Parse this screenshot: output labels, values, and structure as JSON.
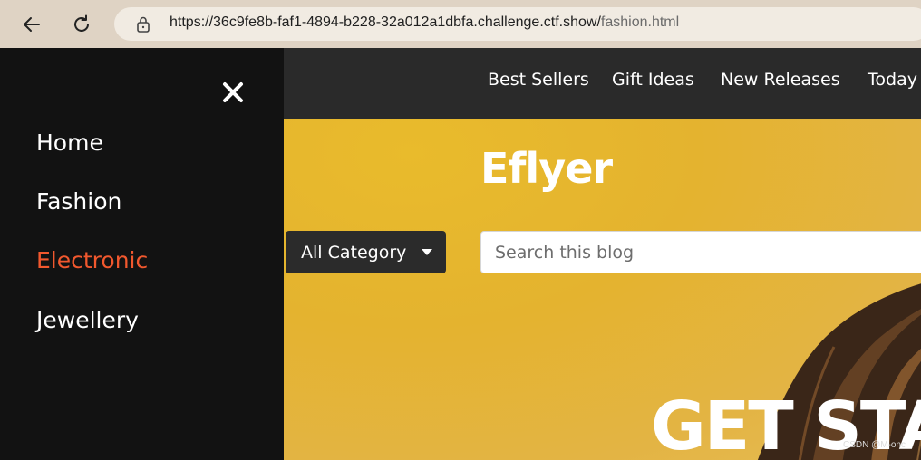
{
  "browser": {
    "url_host": "https://36c9fe8b-faf1-4894-b228-32a012a1dbfa.challenge.ctf.show/",
    "url_path": "fashion.html"
  },
  "sidenav": {
    "items": [
      {
        "label": "Home"
      },
      {
        "label": "Fashion"
      },
      {
        "label": "Electronic",
        "active": true
      },
      {
        "label": "Jewellery"
      }
    ],
    "active_color": "#f1582e"
  },
  "topnav": {
    "items": [
      {
        "label": "Best Sellers"
      },
      {
        "label": "Gift Ideas"
      },
      {
        "label": "New Releases"
      },
      {
        "label": "Today"
      }
    ]
  },
  "header": {
    "logo": "Eflyer",
    "category_label": "All Category",
    "search_placeholder": "Search this blog"
  },
  "hero": {
    "headline": "GET STA",
    "accent_color": "#e4b32f"
  },
  "watermark": "CSDN @M-onc"
}
